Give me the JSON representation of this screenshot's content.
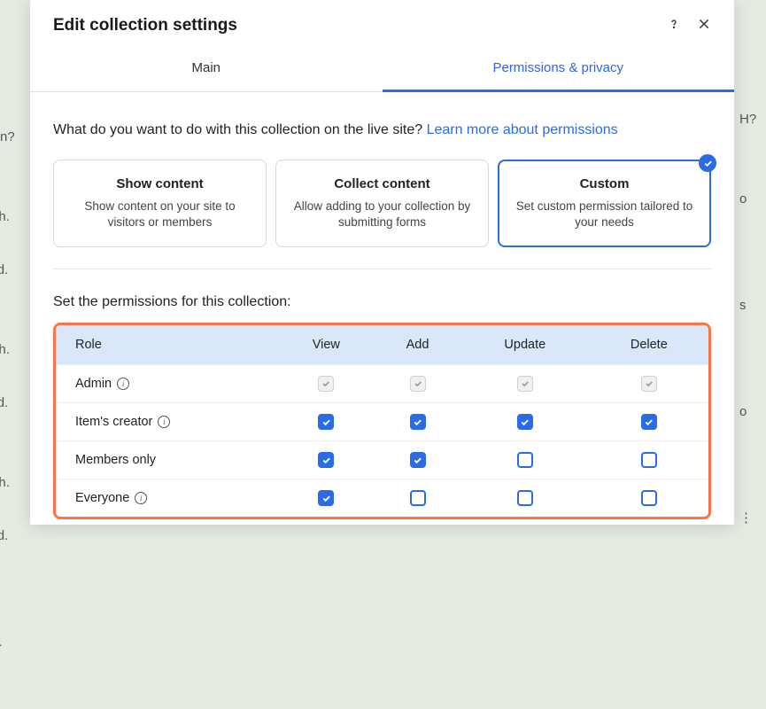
{
  "modal": {
    "title": "Edit collection settings"
  },
  "tabs": {
    "main": "Main",
    "permissions": "Permissions & privacy"
  },
  "question": {
    "text": "What do you want to do with this collection on the live site? ",
    "link": "Learn more about permissions"
  },
  "options": [
    {
      "title": "Show content",
      "desc": "Show content on your site to visitors or members"
    },
    {
      "title": "Collect content",
      "desc": "Allow adding to your collection by submitting forms"
    },
    {
      "title": "Custom",
      "desc": "Set custom permission tailored to your needs"
    }
  ],
  "permSection": {
    "label": "Set the permissions for this collection:"
  },
  "permTable": {
    "headers": [
      "Role",
      "View",
      "Add",
      "Update",
      "Delete"
    ],
    "rows": [
      {
        "label": "Admin",
        "info": true,
        "cells": [
          "locked",
          "locked",
          "locked",
          "locked"
        ]
      },
      {
        "label": "Item's creator",
        "info": true,
        "cells": [
          "checked",
          "checked",
          "checked",
          "checked"
        ]
      },
      {
        "label": "Members only",
        "info": false,
        "cells": [
          "checked",
          "checked",
          "unchecked",
          "unchecked"
        ]
      },
      {
        "label": "Everyone",
        "info": true,
        "cells": [
          "checked",
          "unchecked",
          "unchecked",
          "unchecked"
        ]
      }
    ]
  }
}
